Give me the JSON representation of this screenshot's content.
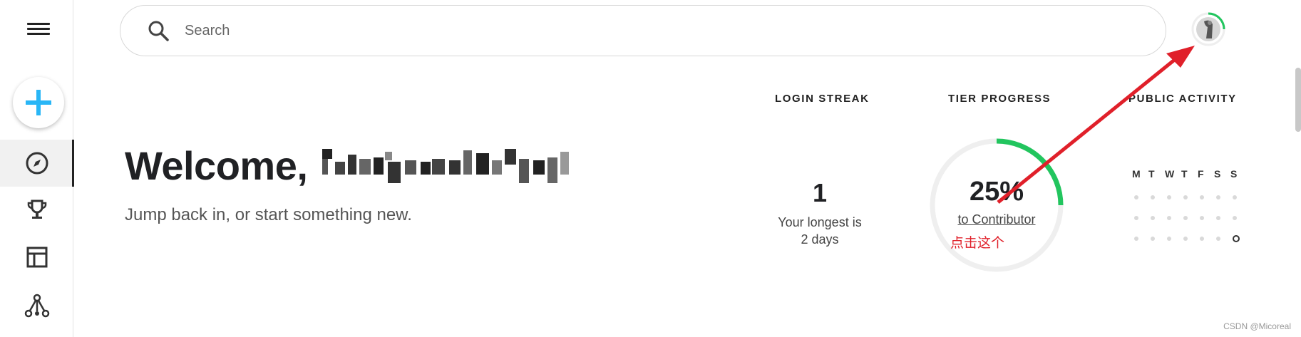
{
  "search": {
    "placeholder": "Search"
  },
  "welcome": {
    "title": "Welcome,",
    "subtitle": "Jump back in, or start something new."
  },
  "stats": {
    "login_streak": {
      "title": "LOGIN STREAK",
      "value": "1",
      "sub_line1": "Your longest is",
      "sub_line2": "2 days"
    },
    "tier_progress": {
      "title": "TIER PROGRESS",
      "percent_label": "25%",
      "progress_fraction": 0.25,
      "link": "to Contributor"
    },
    "public_activity": {
      "title": "PUBLIC ACTIVITY",
      "days": [
        "M",
        "T",
        "W",
        "T",
        "F",
        "S",
        "S"
      ]
    }
  },
  "sidebar": {
    "icons": [
      "menu-icon",
      "plus-icon",
      "compass-icon",
      "trophy-icon",
      "layout-icon",
      "network-icon"
    ]
  },
  "annotation": {
    "text": "点击这个"
  },
  "watermark": "CSDN @Micoreal",
  "colors": {
    "accent_blue": "#29b6f6",
    "progress_green": "#22c55e",
    "annotation_red": "#e0202a"
  }
}
